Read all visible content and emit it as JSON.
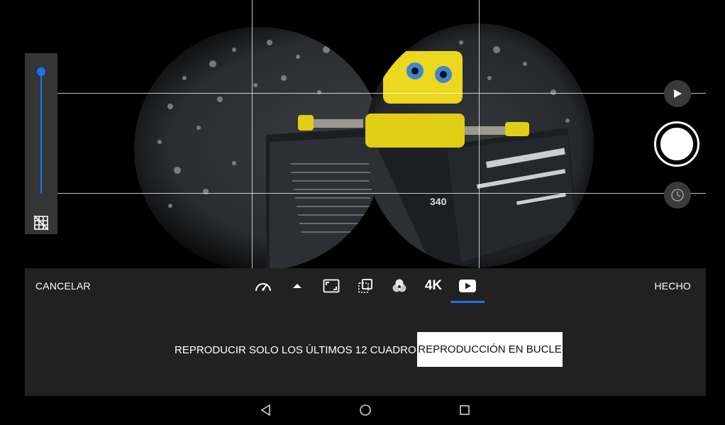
{
  "viewfinder": {
    "photo_description_icon": "robot-reading-book-photo",
    "book_number": "340"
  },
  "zoom": {
    "level": 1.0,
    "grid_icon": "grid-off-icon"
  },
  "camera_controls": {
    "play_icon": "play-icon",
    "shutter_icon": "shutter-icon",
    "timer_icon": "timer-icon"
  },
  "settings_panel": {
    "cancel_label": "CANCELAR",
    "done_label": "HECHO",
    "toolbar": [
      {
        "name": "speed",
        "icon": "speedometer-icon"
      },
      {
        "name": "expand",
        "icon": "arrow-up-icon"
      },
      {
        "name": "aspect",
        "icon": "aspect-ratio-icon"
      },
      {
        "name": "onion",
        "icon": "onion-skin-icon"
      },
      {
        "name": "filter",
        "icon": "color-filter-icon"
      },
      {
        "name": "resolution",
        "label": "4K"
      },
      {
        "name": "playback",
        "icon": "youtube-play-icon",
        "selected": true
      }
    ],
    "resolution_label": "4K",
    "options": {
      "last_frames": "REPRODUCIR SOLO LOS ÚLTIMOS 12 CUADRO",
      "loop": "REPRODUCCIÓN EN BUCLE"
    }
  },
  "nav_bar": {
    "back_icon": "back-triangle-icon",
    "home_icon": "home-circle-icon",
    "recents_icon": "recents-square-icon"
  },
  "colors": {
    "accent": "#1a73e8",
    "panel": "#212121",
    "zoom_panel": "#333537"
  }
}
